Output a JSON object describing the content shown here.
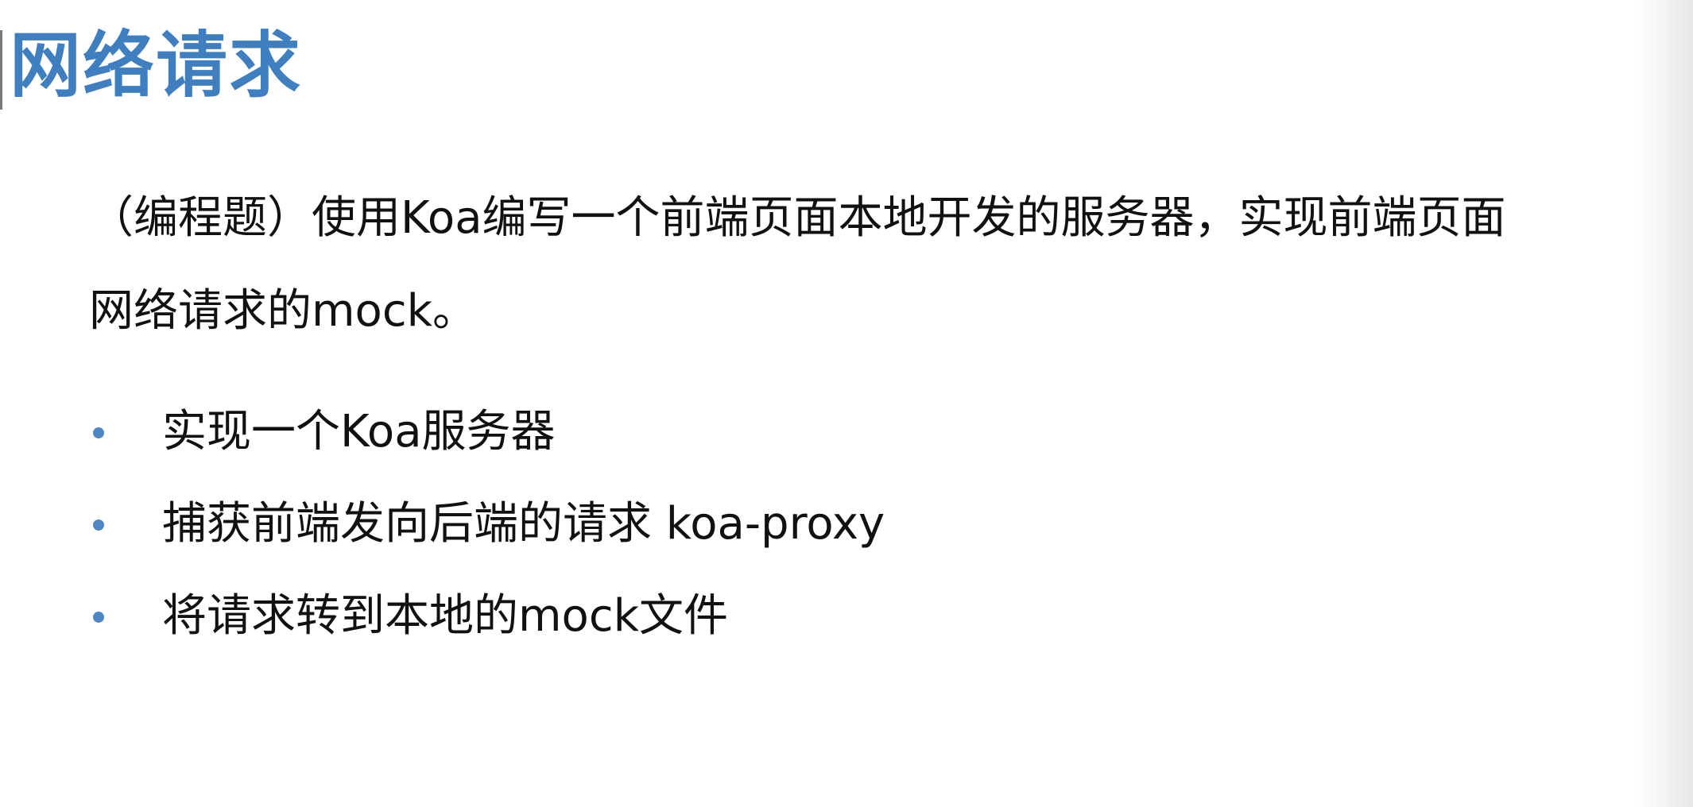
{
  "slide": {
    "title": "网络请求",
    "intro_line1": "（编程题）使用Koa编写一个前端页面本地开发的服务器，实现前端页面",
    "intro_line2": "网络请求的mock。",
    "bullets": [
      "实现一个Koa服务器",
      "捕获前端发向后端的请求 koa-proxy",
      "将请求转到本地的mock文件"
    ]
  },
  "colors": {
    "title": "#3f7fc0",
    "bullet": "#4f86c6",
    "text": "#111111"
  }
}
